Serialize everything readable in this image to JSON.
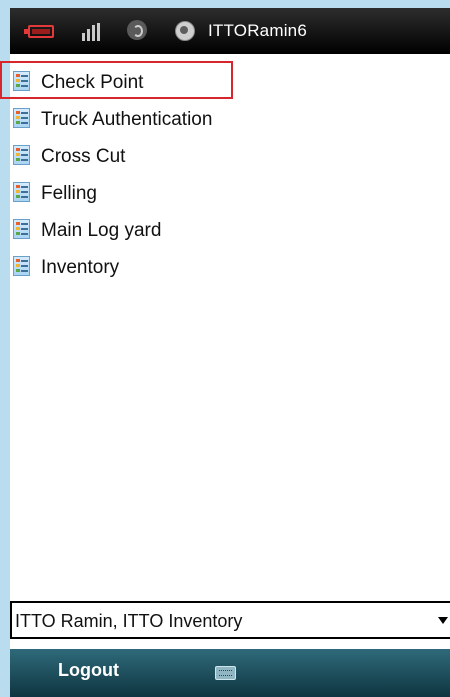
{
  "status_bar": {
    "title": "ITTORamin6",
    "icons": [
      "battery-icon",
      "signal-icon",
      "sync-icon",
      "connect-icon"
    ],
    "colors": {
      "battery": "#e23a3a",
      "background": "#000000"
    }
  },
  "menu": {
    "items": [
      {
        "label": "Check Point",
        "icon": "list-icon",
        "highlighted": true
      },
      {
        "label": "Truck Authentication",
        "icon": "list-icon"
      },
      {
        "label": "Cross Cut",
        "icon": "list-icon"
      },
      {
        "label": "Felling",
        "icon": "list-icon"
      },
      {
        "label": "Main Log yard",
        "icon": "list-icon"
      },
      {
        "label": "Inventory",
        "icon": "list-icon"
      }
    ],
    "highlight_color": "#d7262c"
  },
  "selector": {
    "value": "ITTO Ramin, ITTO Inventory",
    "icon": "chevron-down-icon"
  },
  "softkeys": {
    "left_label": "Logout",
    "center_icon": "keyboard-icon",
    "color": "#1f4f5c"
  }
}
